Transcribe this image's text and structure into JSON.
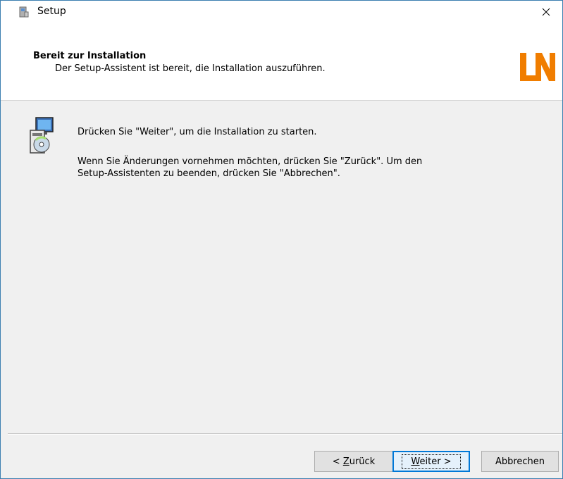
{
  "window": {
    "title": "Setup"
  },
  "header": {
    "title": "Bereit zur Installation",
    "subtitle": "Der Setup-Assistent ist bereit, die Installation auszuführen.",
    "logo_text": "LN",
    "logo_color": "#f07d00"
  },
  "content": {
    "line1": "Drücken Sie \"Weiter\", um die Installation zu starten.",
    "line2a": "Wenn Sie Änderungen vornehmen möchten, drücken Sie \"Zurück\". Um den",
    "line2b": "Setup-Assistenten zu beenden, drücken Sie \"Abbrechen\"."
  },
  "buttons": {
    "back_prefix": "< ",
    "back_accel": "Z",
    "back_rest": "urück",
    "next_accel": "W",
    "next_rest": "eiter >",
    "cancel": "Abbrechen"
  }
}
